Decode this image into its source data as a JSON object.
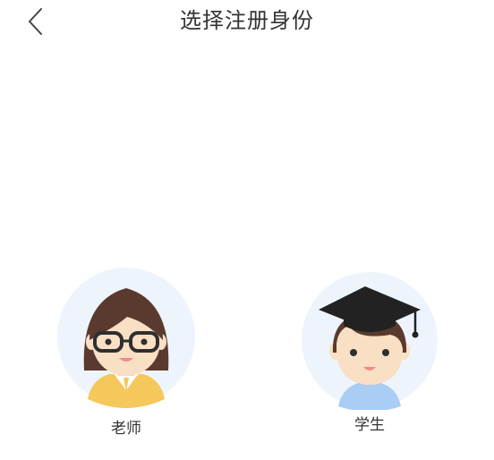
{
  "header": {
    "title": "选择注册身份",
    "back_icon": "chevron-left-icon"
  },
  "roles": [
    {
      "id": "teacher",
      "label": "老师",
      "avatar": "teacher-avatar"
    },
    {
      "id": "student",
      "label": "学生",
      "avatar": "student-avatar"
    }
  ],
  "colors": {
    "title": "#333333",
    "label": "#333333",
    "avatar_bg": "#eef4fc",
    "hair": "#5a3a2e",
    "skin": "#f9dfc4",
    "teacher_top": "#f4c85a",
    "student_top": "#a9cdf5",
    "cap": "#222222"
  }
}
